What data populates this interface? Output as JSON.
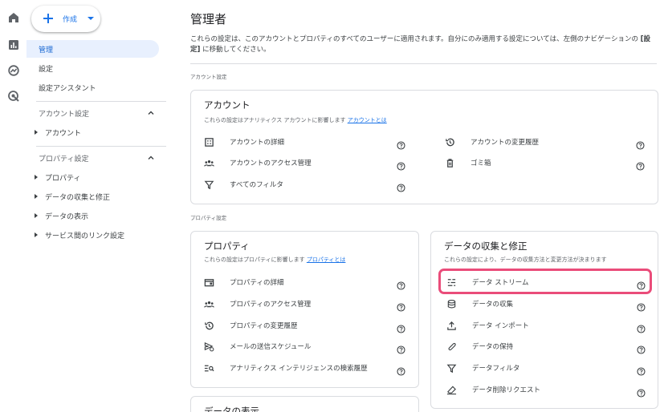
{
  "rail": {
    "icons": [
      "home-icon",
      "reports-icon",
      "explore-icon",
      "advertising-icon"
    ]
  },
  "nav": {
    "create_label": "作成",
    "items": [
      {
        "label": "管理"
      },
      {
        "label": "設定"
      },
      {
        "label": "設定アシスタント"
      }
    ],
    "account_section": {
      "title": "アカウント設定",
      "items": [
        "アカウント"
      ]
    },
    "property_section": {
      "title": "プロパティ設定",
      "items": [
        "プロパティ",
        "データの収集と修正",
        "データの表示",
        "サービス間のリンク設定"
      ]
    }
  },
  "main": {
    "title": "管理者",
    "desc_part1": "これらの設定は、このアカウントとプロパティのすべてのユーザーに適用されます。自分にのみ適用する設定については、左側のナビゲーションの ",
    "desc_bold": "[設定]",
    "desc_part2": " に移動してください。",
    "account_label": "アカウント設定",
    "property_label": "プロパティ設定"
  },
  "account_card": {
    "title": "アカウント",
    "subtitle": "これらの設定はアナリティクス アカウントに影響します",
    "subtitle_link": "アカウントとは",
    "rows": [
      {
        "label": "アカウントの詳細"
      },
      {
        "label": "アカウントの変更履歴"
      },
      {
        "label": "アカウントのアクセス管理"
      },
      {
        "label": "ゴミ箱"
      },
      {
        "label": "すべてのフィルタ"
      }
    ]
  },
  "property_card": {
    "title": "プロパティ",
    "subtitle": "これらの設定はプロパティに影響します",
    "subtitle_link": "プロパティとは",
    "rows": [
      {
        "label": "プロパティの詳細"
      },
      {
        "label": "プロパティのアクセス管理"
      },
      {
        "label": "プロパティの変更履歴"
      },
      {
        "label": "メールの送信スケジュール"
      },
      {
        "label": "アナリティクス インテリジェンスの検索履歴"
      }
    ]
  },
  "data_card": {
    "title": "データの収集と修正",
    "subtitle": "これらの設定により、データの収集方法と変更方法が決まります",
    "rows": [
      {
        "label": "データ ストリーム"
      },
      {
        "label": "データの収集"
      },
      {
        "label": "データ インポート"
      },
      {
        "label": "データの保持"
      },
      {
        "label": "データフィルタ"
      },
      {
        "label": "データ削除リクエスト"
      }
    ]
  },
  "display_card": {
    "title": "データの表示"
  },
  "colors": {
    "accent": "#1a73e8",
    "active_bg": "#e8f0fe",
    "highlight": "#ea4c7a"
  }
}
